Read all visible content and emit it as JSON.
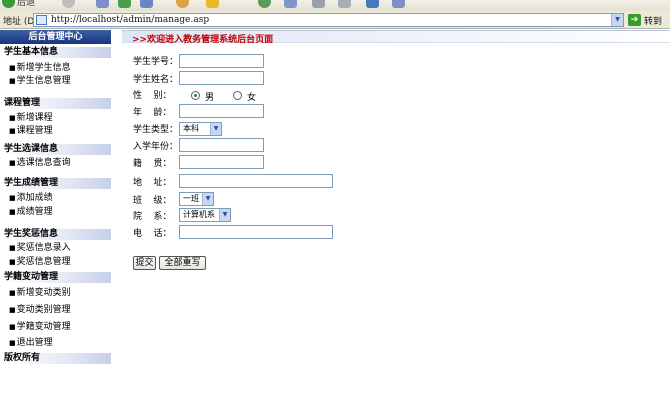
{
  "browser": {
    "toolbar": {
      "back_label": "后退"
    },
    "address_label": "地址 (D)",
    "address_url": "http://localhost/admin/manage.asp",
    "goto_label": "转到"
  },
  "sidebar": {
    "header": "后台管理中心",
    "sections": [
      {
        "title": "学生基本信息",
        "items": [
          "新增学生信息",
          "学生信息管理"
        ]
      },
      {
        "title": "课程管理",
        "items": [
          "新增课程",
          "课程管理"
        ]
      },
      {
        "title": "学生选课信息",
        "items": [
          "选课信息查询"
        ]
      },
      {
        "title": "学生成绩管理",
        "items": [
          "添加成绩",
          "成绩管理"
        ]
      },
      {
        "title": "学生奖惩信息",
        "items": [
          "奖惩信息录入",
          "奖惩信息管理"
        ]
      },
      {
        "title": "学籍变动管理",
        "items": [
          "新增变动类别",
          "变动类别管理",
          "学籍变动管理",
          "退出管理"
        ]
      },
      {
        "title": "版权所有",
        "items": []
      }
    ]
  },
  "main": {
    "welcome": ">>欢迎进入教务管理系统后台页面",
    "form": {
      "student_id_label": "学生学号：",
      "student_name_label": "学生姓名：",
      "gender_label": "性    别：",
      "gender_male": "男",
      "gender_female": "女",
      "age_label": "年    龄：",
      "student_type_label": "学生类型：",
      "student_type_value": "本科",
      "enroll_year_label": "入学年份：",
      "hometown_label": "籍    贯：",
      "address_label": "地    址：",
      "class_label": "班    级：",
      "class_value": "一班",
      "department_label": "院    系：",
      "department_value": "计算机系",
      "phone_label": "电    话：",
      "submit_label": "提交",
      "reset_label": "全部重写"
    }
  }
}
